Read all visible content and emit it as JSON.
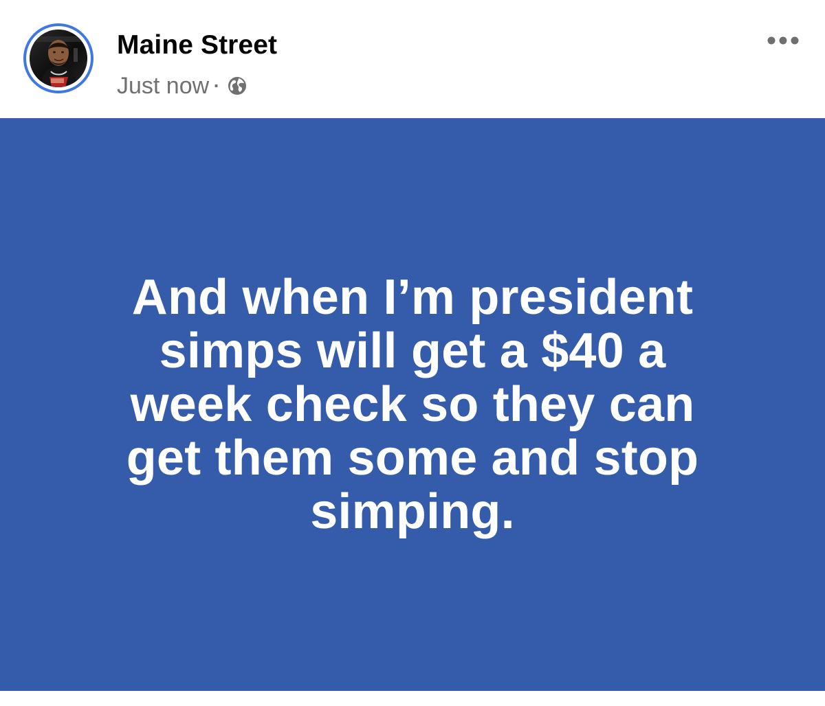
{
  "post": {
    "author": {
      "name": "Maine Street",
      "avatar_icon": "profile-photo"
    },
    "meta": {
      "timestamp": "Just now",
      "separator": "·",
      "privacy_icon": "globe-icon"
    },
    "actions": {
      "more_icon": "more-options-icon"
    },
    "text": "And when I’m president\nsimps will get a $40 a\nweek check so they can\nget them some and stop\nsimping.",
    "colors": {
      "background": "#ffffff",
      "author_text": "#050505",
      "meta_text": "#707070",
      "avatar_ring": "#3f78e5",
      "post_background": "#355bab",
      "post_text": "#ffffff"
    }
  }
}
